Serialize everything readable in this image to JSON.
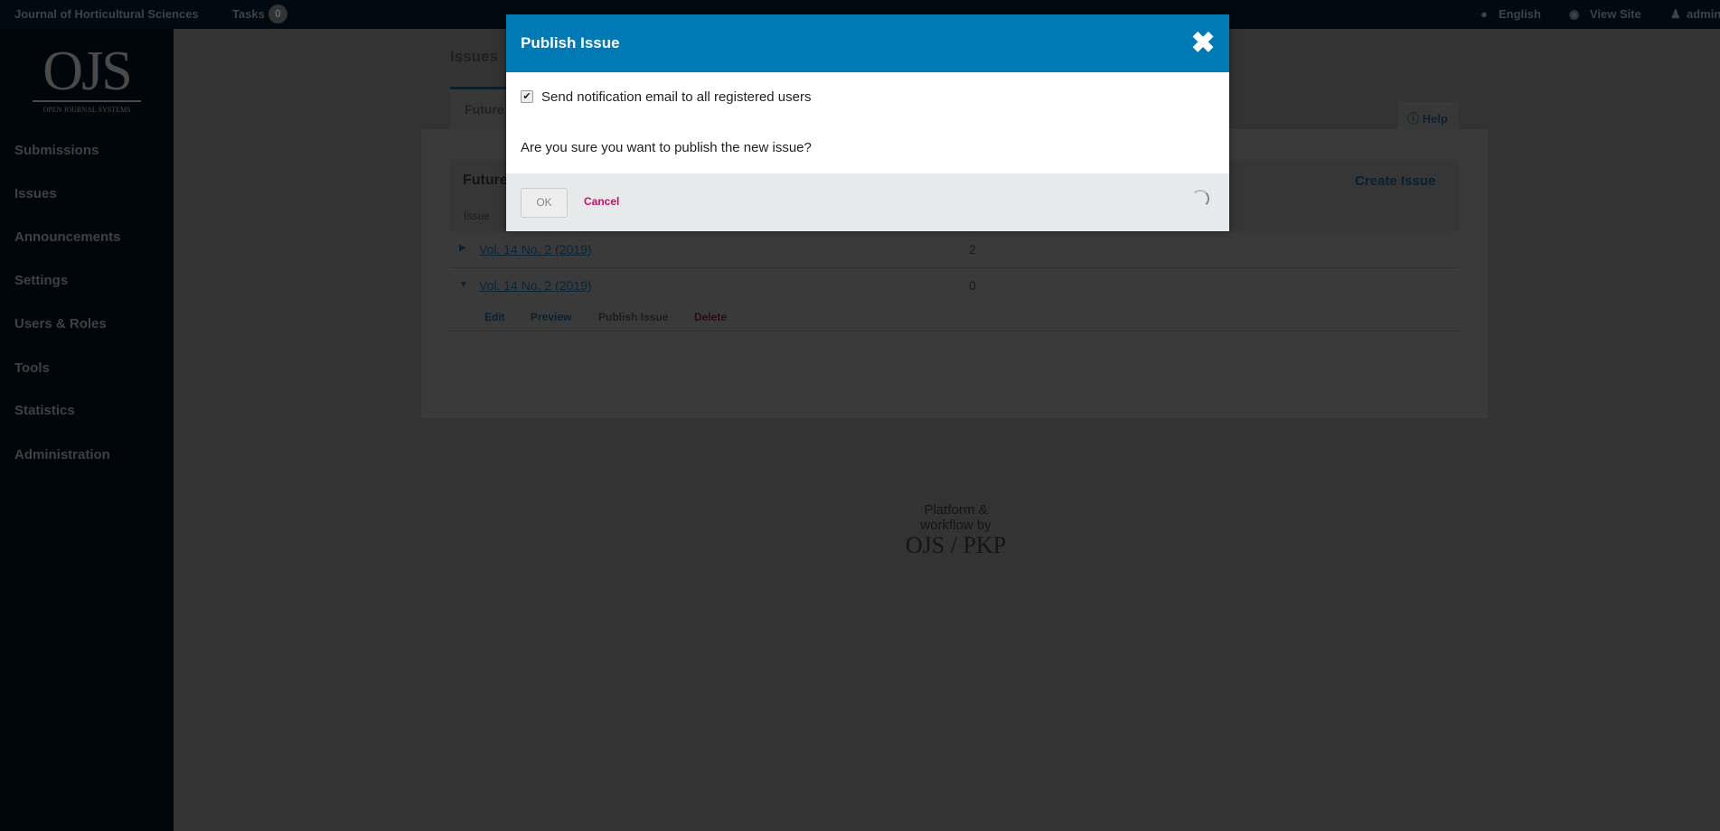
{
  "topbar": {
    "journal": "Journal of Horticultural Sciences",
    "tasks_label": "Tasks",
    "tasks_count": "0",
    "language": "English",
    "view_site": "View Site",
    "user": "admin"
  },
  "sidebar": {
    "logo": "OJS",
    "logo_sub": "OPEN JOURNAL SYSTEMS",
    "items": [
      {
        "label": "Submissions"
      },
      {
        "label": "Issues"
      },
      {
        "label": "Announcements"
      },
      {
        "label": "Settings"
      },
      {
        "label": "Users & Roles"
      },
      {
        "label": "Tools"
      },
      {
        "label": "Statistics"
      },
      {
        "label": "Administration"
      }
    ]
  },
  "main": {
    "title": "Issues",
    "tab": "Future",
    "help": "Help",
    "grid_title": "Future",
    "create_issue": "Create Issue",
    "col_issue": "Issue",
    "rows": [
      {
        "issue": "Vol. 14 No. 2 (2019)",
        "count": "2",
        "expanded": false
      },
      {
        "issue": "Vol. 14 No. 2 (2019)",
        "count": "0",
        "expanded": true
      }
    ],
    "actions": {
      "edit": "Edit",
      "preview": "Preview",
      "publish": "Publish Issue",
      "delete": "Delete"
    }
  },
  "footer": {
    "line1": "Platform &",
    "line2": "workflow by",
    "brand": "OJS / PKP"
  },
  "modal": {
    "title": "Publish Issue",
    "checkbox_label": "Send notification email to all registered users",
    "checked": true,
    "question": "Are you sure you want to publish the new issue?",
    "ok": "OK",
    "cancel": "Cancel"
  },
  "colors": {
    "modal_header": "#007ab5",
    "cancel": "#d00a6c"
  }
}
